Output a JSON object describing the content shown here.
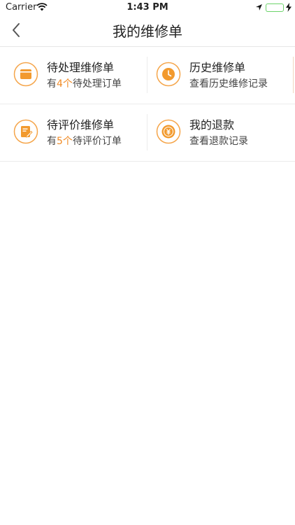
{
  "status_bar": {
    "carrier": "Carrier",
    "time": "1:43 PM"
  },
  "nav": {
    "title": "我的维修单"
  },
  "cards": {
    "pending": {
      "title": "待处理维修单",
      "sub_prefix": "有",
      "count": "4个",
      "sub_suffix": "待处理订单"
    },
    "history": {
      "title": "历史维修单",
      "sub": "查看历史维修记录"
    },
    "review": {
      "title": "待评价维修单",
      "sub_prefix": "有",
      "count": "5个",
      "sub_suffix": "待评价订单"
    },
    "refund": {
      "title": "我的退款",
      "sub": "查看退款记录"
    }
  },
  "colors": {
    "accent": "#f08a24",
    "icon_ring": "#f5a54a",
    "battery": "#4cd964"
  },
  "icons": {
    "pending": "folder-icon",
    "history": "clock-icon",
    "review": "edit-document-icon",
    "refund": "yuan-coin-icon"
  }
}
